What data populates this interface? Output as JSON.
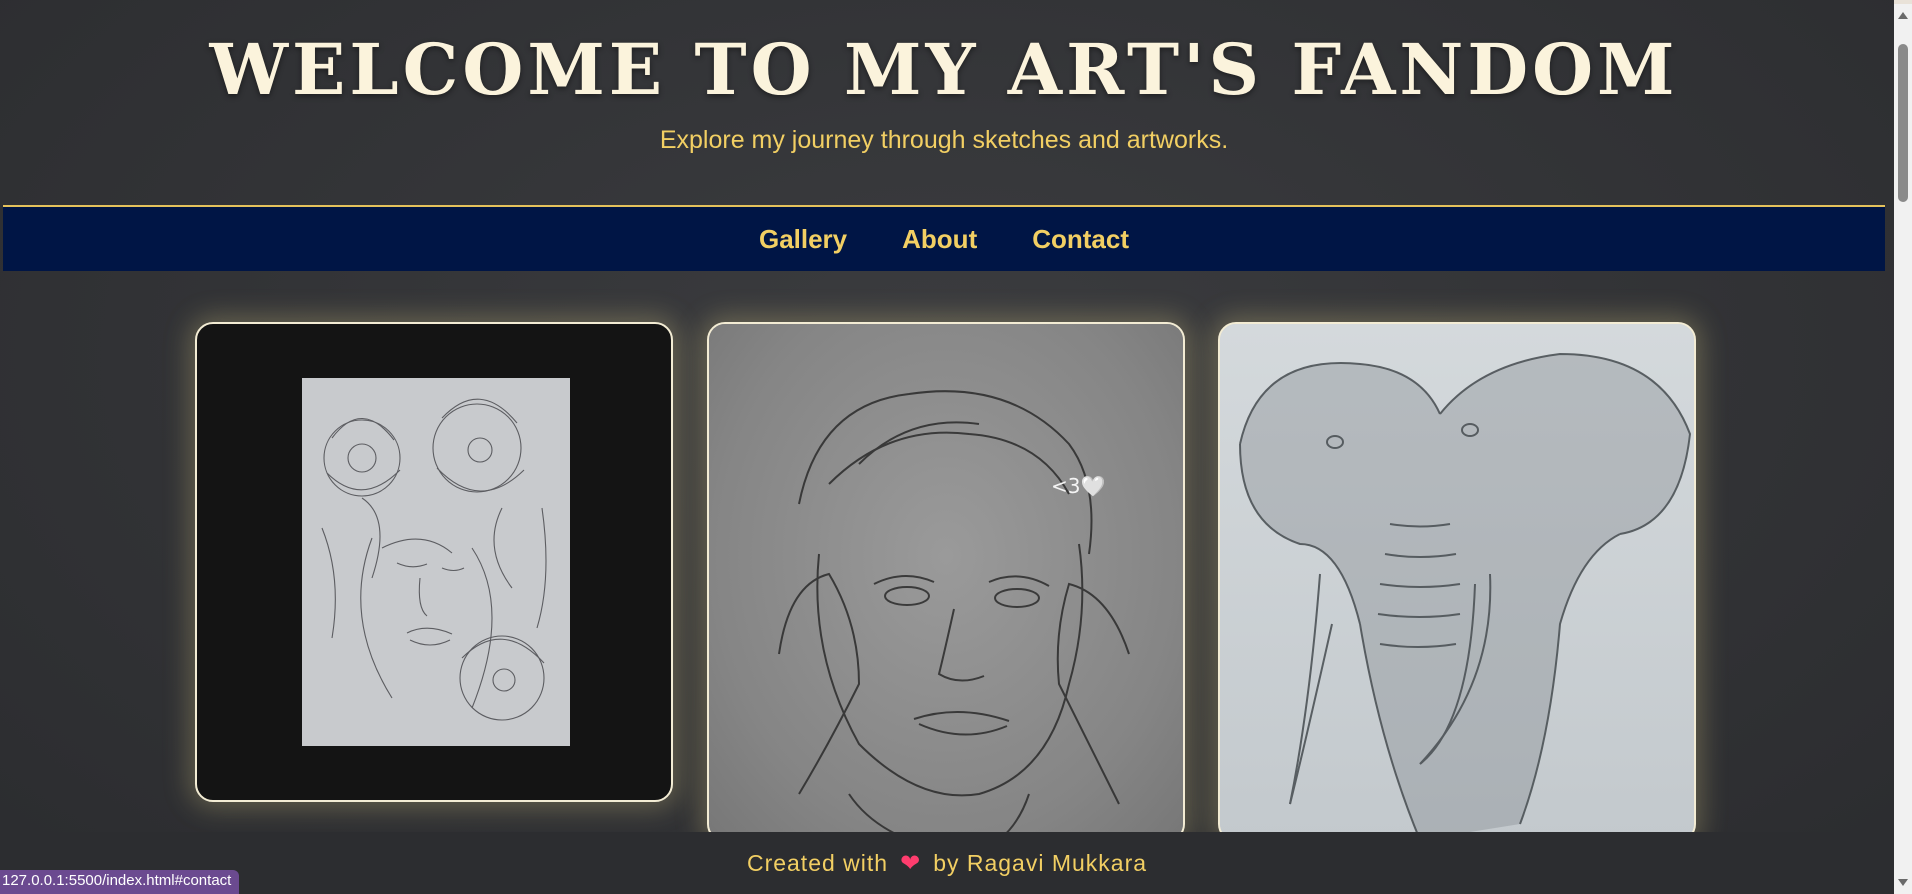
{
  "header": {
    "title": "WELCOME TO MY ART'S FANDOM",
    "tagline": "Explore my journey through sketches and artworks."
  },
  "nav": {
    "items": [
      {
        "label": "Gallery"
      },
      {
        "label": "About"
      },
      {
        "label": "Contact"
      }
    ]
  },
  "gallery": {
    "items": [
      {
        "subject": "woman-with-flowers-sketch",
        "icon": "flower-portrait-sketch"
      },
      {
        "subject": "boy-portrait-sketch",
        "icon": "boy-portrait-sketch",
        "note": "<3🤍"
      },
      {
        "subject": "elephant-sketch",
        "icon": "elephant-sketch"
      }
    ]
  },
  "footer": {
    "prefix": "Created with",
    "heart": "❤",
    "suffix": "by Ragavi Mukkara"
  },
  "status_bar": {
    "url": "127.0.0.1:5500/index.html#contact"
  },
  "colors": {
    "accent": "#f2cf63",
    "title": "#fbf3dc",
    "nav_bg": "#001545",
    "page_bg": "#333437",
    "card_border": "#f3ecd4"
  }
}
